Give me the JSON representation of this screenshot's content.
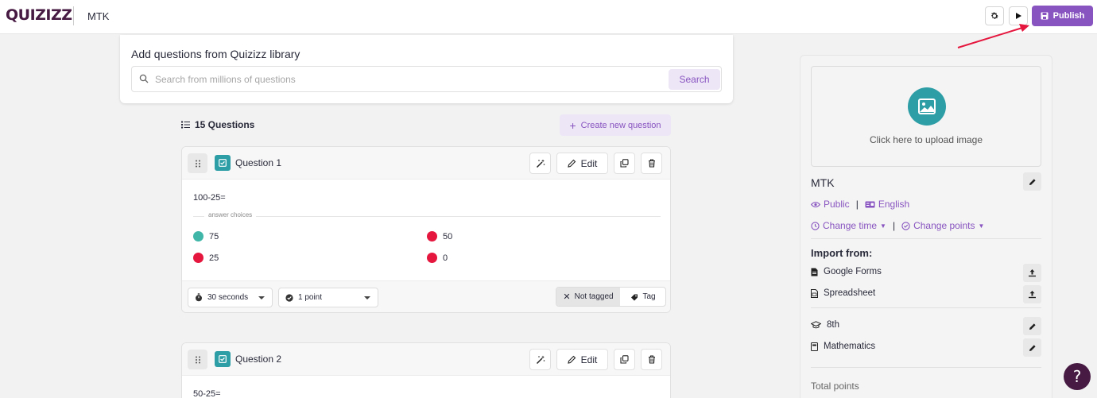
{
  "header": {
    "logo": "QUIZIZZ",
    "quiz_name": "MTK",
    "publish_label": "Publish",
    "settings_icon": "gear-icon",
    "preview_icon": "play-icon"
  },
  "library": {
    "title": "Add questions from Quizizz library",
    "placeholder": "Search from millions of questions",
    "search_label": "Search"
  },
  "questions_header": {
    "count_label": "15 Questions",
    "create_label": "Create new question"
  },
  "questions": [
    {
      "label": "Question 1",
      "text": "100-25=",
      "answer_choices_label": "answer choices",
      "choices": [
        {
          "text": "75",
          "correct": true
        },
        {
          "text": "50",
          "correct": false
        },
        {
          "text": "25",
          "correct": false
        },
        {
          "text": "0",
          "correct": false
        }
      ],
      "edit_label": "Edit",
      "time": "30 seconds",
      "points": "1 point",
      "not_tagged": "Not tagged",
      "tag": "Tag"
    },
    {
      "label": "Question 2",
      "text": "50-25=",
      "edit_label": "Edit"
    }
  ],
  "sidebar": {
    "upload_text": "Click here to upload image",
    "title": "MTK",
    "visibility": "Public",
    "language": "English",
    "change_time": "Change time",
    "change_points": "Change points",
    "import_title": "Import from:",
    "import_items": [
      "Google Forms",
      "Spreadsheet"
    ],
    "grade": "8th",
    "subject": "Mathematics",
    "total_points_label": "Total points"
  },
  "colors": {
    "brand_purple": "#8854c0",
    "logo_purple": "#461a42",
    "teal": "#2d9da6",
    "correct": "#3fb6a8",
    "incorrect": "#e5173f"
  }
}
